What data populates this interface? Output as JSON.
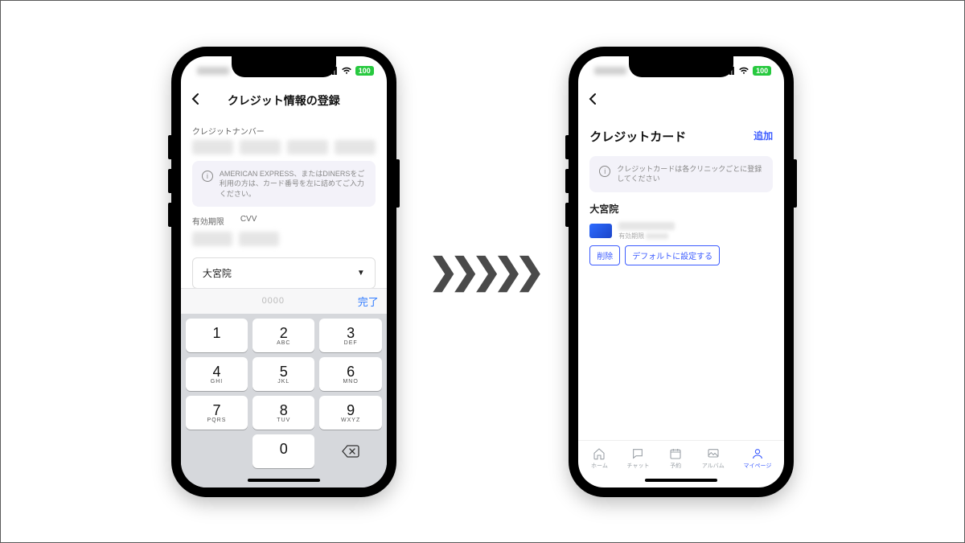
{
  "status": {
    "battery": "100"
  },
  "screen1": {
    "title": "クレジット情報の登録",
    "card_number_label": "クレジットナンバー",
    "info_text": "AMERICAN EXPRESS、またはDINERSをご利用の方は、カード番号を左に詰めてご入力ください。",
    "expiry_label": "有効期限",
    "cvv_label": "CVV",
    "clinic_selected": "大宮院",
    "kb_placeholder": "0000",
    "kb_done": "完了",
    "keys": [
      {
        "n": "1",
        "s": ""
      },
      {
        "n": "2",
        "s": "ABC"
      },
      {
        "n": "3",
        "s": "DEF"
      },
      {
        "n": "4",
        "s": "GHI"
      },
      {
        "n": "5",
        "s": "JKL"
      },
      {
        "n": "6",
        "s": "MNO"
      },
      {
        "n": "7",
        "s": "PQRS"
      },
      {
        "n": "8",
        "s": "TUV"
      },
      {
        "n": "9",
        "s": "WXYZ"
      },
      {
        "n": "",
        "s": ""
      },
      {
        "n": "0",
        "s": ""
      },
      {
        "n": "del",
        "s": ""
      }
    ]
  },
  "screen2": {
    "title": "クレジットカード",
    "add_label": "追加",
    "info_text": "クレジットカードは各クリニックごとに登録してください",
    "clinic_name": "大宮院",
    "card_exp_prefix": "有効期限",
    "delete_label": "削除",
    "default_label": "デフォルトに設定する",
    "tabs": [
      {
        "label": "ホーム"
      },
      {
        "label": "チャット"
      },
      {
        "label": "予約"
      },
      {
        "label": "アルバム"
      },
      {
        "label": "マイページ"
      }
    ]
  }
}
